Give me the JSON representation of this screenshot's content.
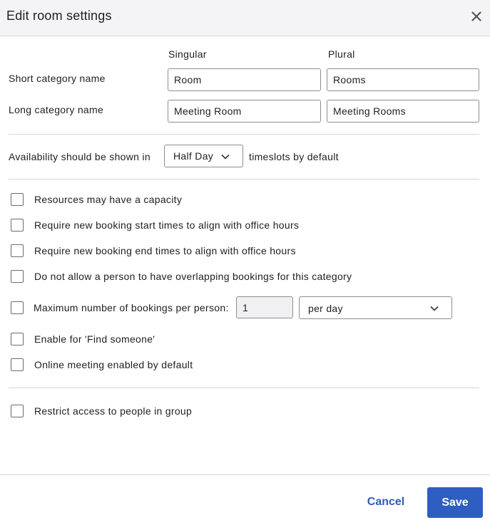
{
  "dialog": {
    "title": "Edit room settings",
    "close_icon": "close-icon"
  },
  "names": {
    "singular_header": "Singular",
    "plural_header": "Plural",
    "short_label": "Short category name",
    "long_label": "Long category name",
    "short_singular": "Room",
    "short_plural": "Rooms",
    "long_singular": "Meeting Room",
    "long_plural": "Meeting Rooms"
  },
  "availability": {
    "prefix": "Availability should be shown in",
    "selected": "Half Day",
    "suffix": "timeslots by default"
  },
  "options": {
    "capacity": "Resources may have a capacity",
    "start_align": "Require new booking start times to align with office hours",
    "end_align": "Require new booking end times to align with office hours",
    "no_overlap": "Do not allow a person to have overlapping bookings for this category",
    "max_label": "Maximum number of bookings per person:",
    "max_value": "1",
    "max_period": "per day",
    "find_someone": "Enable for 'Find someone'",
    "online_meeting": "Online meeting enabled by default"
  },
  "access": {
    "restrict": "Restrict access to people in group"
  },
  "footer": {
    "cancel": "Cancel",
    "save": "Save"
  },
  "colors": {
    "primary": "#2f5ec2",
    "link": "#2f5bb7",
    "header_bg": "#f4f4f6",
    "divider": "#d6d6da"
  }
}
